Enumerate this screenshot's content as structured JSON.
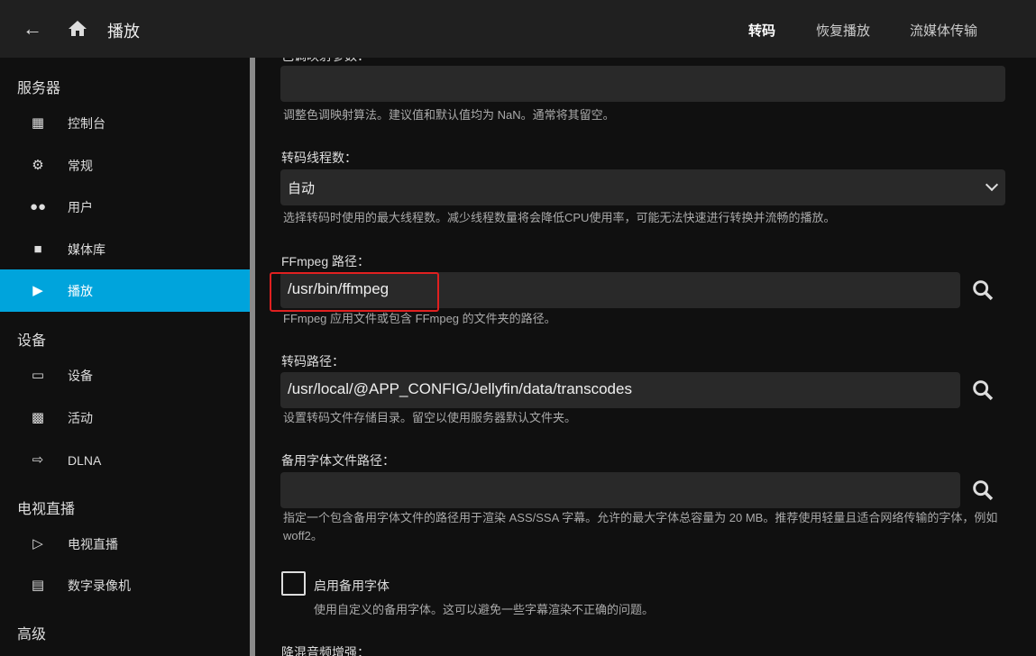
{
  "header": {
    "title": "播放",
    "tabs": [
      "转码",
      "恢复播放",
      "流媒体传输"
    ],
    "active_tab": 0
  },
  "sidebar": {
    "sections": [
      {
        "title": "服务器",
        "items": [
          {
            "label": "控制台",
            "icon": "dashboard-icon"
          },
          {
            "label": "常规",
            "icon": "gear-icon"
          },
          {
            "label": "用户",
            "icon": "people-icon"
          },
          {
            "label": "媒体库",
            "icon": "folder-icon"
          },
          {
            "label": "播放",
            "icon": "play-icon",
            "active": true
          }
        ]
      },
      {
        "title": "设备",
        "items": [
          {
            "label": "设备",
            "icon": "devices-icon"
          },
          {
            "label": "活动",
            "icon": "chart-icon"
          },
          {
            "label": "DLNA",
            "icon": "input-icon"
          }
        ]
      },
      {
        "title": "电视直播",
        "items": [
          {
            "label": "电视直播",
            "icon": "live-tv-icon"
          },
          {
            "label": "数字录像机",
            "icon": "dvr-icon"
          }
        ]
      },
      {
        "title": "高级",
        "items": []
      }
    ]
  },
  "form": {
    "tonemap_param": {
      "label": "色调映射参数：",
      "value": "",
      "help": "调整色调映射算法。建议值和默认值均为 NaN。通常将其留空。"
    },
    "threads": {
      "label": "转码线程数：",
      "value": "自动",
      "help": "选择转码时使用的最大线程数。减少线程数量将会降低CPU使用率，可能无法快速进行转换并流畅的播放。"
    },
    "ffmpeg": {
      "label": "FFmpeg 路径：",
      "value": "/usr/bin/ffmpeg",
      "help": "FFmpeg 应用文件或包含 FFmpeg 的文件夹的路径。"
    },
    "transcode_path": {
      "label": "转码路径：",
      "value": "/usr/local/@APP_CONFIG/Jellyfin/data/transcodes",
      "help": "设置转码文件存储目录。留空以使用服务器默认文件夹。"
    },
    "fallback_font_path": {
      "label": "备用字体文件路径：",
      "value": "",
      "help": "指定一个包含备用字体文件的路径用于渲染 ASS/SSA 字幕。允许的最大字体总容量为 20 MB。推荐使用轻量且适合网络传输的字体，例如 woff2。"
    },
    "enable_fallback_font": {
      "label": "启用备用字体",
      "checked": false,
      "help": "使用自定义的备用字体。这可以避免一些字幕渲染不正确的问题。"
    },
    "downmix_boost": {
      "label": "降混音频增强："
    }
  },
  "colors": {
    "accent": "#00a4dc",
    "highlight": "#e02020"
  }
}
